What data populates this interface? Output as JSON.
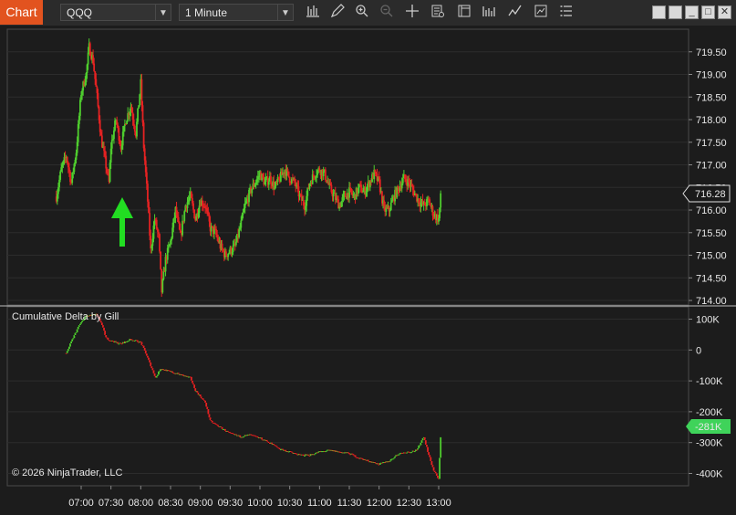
{
  "toolbar": {
    "chart_tab": "Chart",
    "instrument": "QQQ",
    "interval": "1 Minute",
    "tools": [
      "bars-icon",
      "pencil-icon",
      "zoom-in-icon",
      "zoom-out-icon",
      "crosshair-icon",
      "data-box-icon",
      "properties-icon",
      "indicators-icon",
      "strategies-icon",
      "drawing-tools-icon",
      "list-icon"
    ]
  },
  "colors": {
    "up": "#4fce2e",
    "down": "#e52222",
    "background": "#1c1c1c",
    "grid": "#2f2f2f",
    "accent": "#e2531f",
    "arrow": "#22dd22"
  },
  "price_panel": {
    "ticks": [
      "719.50",
      "719.00",
      "718.50",
      "718.00",
      "717.50",
      "717.00",
      "716.50",
      "716.00",
      "715.50",
      "715.00",
      "714.50",
      "714.00"
    ],
    "current_price": "716.28",
    "ylim": [
      713.9,
      720.0
    ]
  },
  "delta_panel": {
    "title": "Cumulative Delta by Gill",
    "ticks": [
      "100K",
      "0",
      "-100K",
      "-200K",
      "-300K",
      "-400K"
    ],
    "current_value": "-281K",
    "copyright": "© 2026 NinjaTrader, LLC"
  },
  "time_axis": [
    "07:00",
    "07:30",
    "08:00",
    "08:30",
    "09:00",
    "09:30",
    "10:00",
    "10:30",
    "11:00",
    "11:30",
    "12:00",
    "12:30",
    "13:00"
  ],
  "chart_data": [
    {
      "type": "candlestick",
      "title": "QQQ 1 Minute",
      "x_range": [
        "06:35",
        "13:02"
      ],
      "ylim": [
        713.9,
        720.0
      ],
      "close_path": [
        [
          "06:35",
          716.3
        ],
        [
          "06:40",
          716.9
        ],
        [
          "06:45",
          717.2
        ],
        [
          "06:50",
          716.6
        ],
        [
          "06:55",
          717.3
        ],
        [
          "07:00",
          718.6
        ],
        [
          "07:05",
          719.0
        ],
        [
          "07:08",
          719.6
        ],
        [
          "07:12",
          719.3
        ],
        [
          "07:16",
          718.5
        ],
        [
          "07:20",
          717.6
        ],
        [
          "07:24",
          717.1
        ],
        [
          "07:28",
          716.6
        ],
        [
          "07:30",
          717.4
        ],
        [
          "07:35",
          718.0
        ],
        [
          "07:40",
          717.4
        ],
        [
          "07:45",
          718.0
        ],
        [
          "07:50",
          718.3
        ],
        [
          "07:55",
          717.7
        ],
        [
          "08:00",
          718.8
        ],
        [
          "08:03",
          717.4
        ],
        [
          "08:07",
          716.2
        ],
        [
          "08:10",
          715.1
        ],
        [
          "08:14",
          715.8
        ],
        [
          "08:18",
          715.4
        ],
        [
          "08:21",
          714.2
        ],
        [
          "08:25",
          714.9
        ],
        [
          "08:30",
          715.3
        ],
        [
          "08:35",
          716.0
        ],
        [
          "08:40",
          715.4
        ],
        [
          "08:45",
          716.1
        ],
        [
          "08:50",
          716.3
        ],
        [
          "08:55",
          715.8
        ],
        [
          "09:00",
          716.2
        ],
        [
          "09:05",
          716.1
        ],
        [
          "09:10",
          715.6
        ],
        [
          "09:15",
          715.5
        ],
        [
          "09:20",
          715.2
        ],
        [
          "09:25",
          715.0
        ],
        [
          "09:30",
          715.1
        ],
        [
          "09:35",
          715.2
        ],
        [
          "09:40",
          715.6
        ],
        [
          "09:45",
          716.1
        ],
        [
          "09:50",
          716.4
        ],
        [
          "09:55",
          716.6
        ],
        [
          "10:00",
          716.8
        ],
        [
          "10:05",
          716.6
        ],
        [
          "10:10",
          716.7
        ],
        [
          "10:15",
          716.5
        ],
        [
          "10:20",
          716.7
        ],
        [
          "10:25",
          716.9
        ],
        [
          "10:30",
          716.7
        ],
        [
          "10:35",
          716.6
        ],
        [
          "10:40",
          716.3
        ],
        [
          "10:45",
          716.1
        ],
        [
          "10:50",
          716.6
        ],
        [
          "10:55",
          716.8
        ],
        [
          "11:00",
          716.9
        ],
        [
          "11:05",
          716.8
        ],
        [
          "11:10",
          716.5
        ],
        [
          "11:15",
          716.3
        ],
        [
          "11:20",
          716.1
        ],
        [
          "11:25",
          716.3
        ],
        [
          "11:30",
          716.4
        ],
        [
          "11:35",
          716.3
        ],
        [
          "11:40",
          716.5
        ],
        [
          "11:45",
          716.4
        ],
        [
          "11:50",
          716.6
        ],
        [
          "11:55",
          716.8
        ],
        [
          "12:00",
          716.6
        ],
        [
          "12:05",
          716.0
        ],
        [
          "12:10",
          716.0
        ],
        [
          "12:15",
          716.3
        ],
        [
          "12:20",
          716.5
        ],
        [
          "12:25",
          716.7
        ],
        [
          "12:30",
          716.6
        ],
        [
          "12:35",
          716.4
        ],
        [
          "12:40",
          716.2
        ],
        [
          "12:45",
          716.1
        ],
        [
          "12:50",
          716.2
        ],
        [
          "12:55",
          715.9
        ],
        [
          "13:00",
          715.8
        ],
        [
          "13:02",
          716.28
        ]
      ]
    },
    {
      "type": "candlestick",
      "title": "Cumulative Delta by Gill",
      "x_range": [
        "06:35",
        "13:02"
      ],
      "ylim": [
        -440000,
        140000
      ],
      "close_path": [
        [
          "06:45",
          -10000
        ],
        [
          "06:52",
          40000
        ],
        [
          "06:58",
          80000
        ],
        [
          "07:05",
          110000
        ],
        [
          "07:15",
          115000
        ],
        [
          "07:20",
          90000
        ],
        [
          "07:25",
          40000
        ],
        [
          "07:30",
          30000
        ],
        [
          "07:40",
          20000
        ],
        [
          "07:50",
          35000
        ],
        [
          "08:00",
          25000
        ],
        [
          "08:05",
          -10000
        ],
        [
          "08:10",
          -50000
        ],
        [
          "08:15",
          -90000
        ],
        [
          "08:20",
          -60000
        ],
        [
          "08:30",
          -70000
        ],
        [
          "08:40",
          -80000
        ],
        [
          "08:50",
          -90000
        ],
        [
          "08:55",
          -130000
        ],
        [
          "09:05",
          -170000
        ],
        [
          "09:10",
          -230000
        ],
        [
          "09:20",
          -250000
        ],
        [
          "09:30",
          -270000
        ],
        [
          "09:40",
          -280000
        ],
        [
          "09:50",
          -275000
        ],
        [
          "10:00",
          -285000
        ],
        [
          "10:10",
          -300000
        ],
        [
          "10:20",
          -320000
        ],
        [
          "10:30",
          -330000
        ],
        [
          "10:40",
          -340000
        ],
        [
          "10:50",
          -340000
        ],
        [
          "11:00",
          -330000
        ],
        [
          "11:10",
          -325000
        ],
        [
          "11:20",
          -330000
        ],
        [
          "11:30",
          -335000
        ],
        [
          "11:40",
          -350000
        ],
        [
          "11:50",
          -360000
        ],
        [
          "12:00",
          -370000
        ],
        [
          "12:10",
          -360000
        ],
        [
          "12:20",
          -335000
        ],
        [
          "12:30",
          -330000
        ],
        [
          "12:38",
          -325000
        ],
        [
          "12:45",
          -280000
        ],
        [
          "12:50",
          -340000
        ],
        [
          "12:55",
          -390000
        ],
        [
          "13:00",
          -420000
        ],
        [
          "13:02",
          -281000
        ]
      ]
    }
  ]
}
